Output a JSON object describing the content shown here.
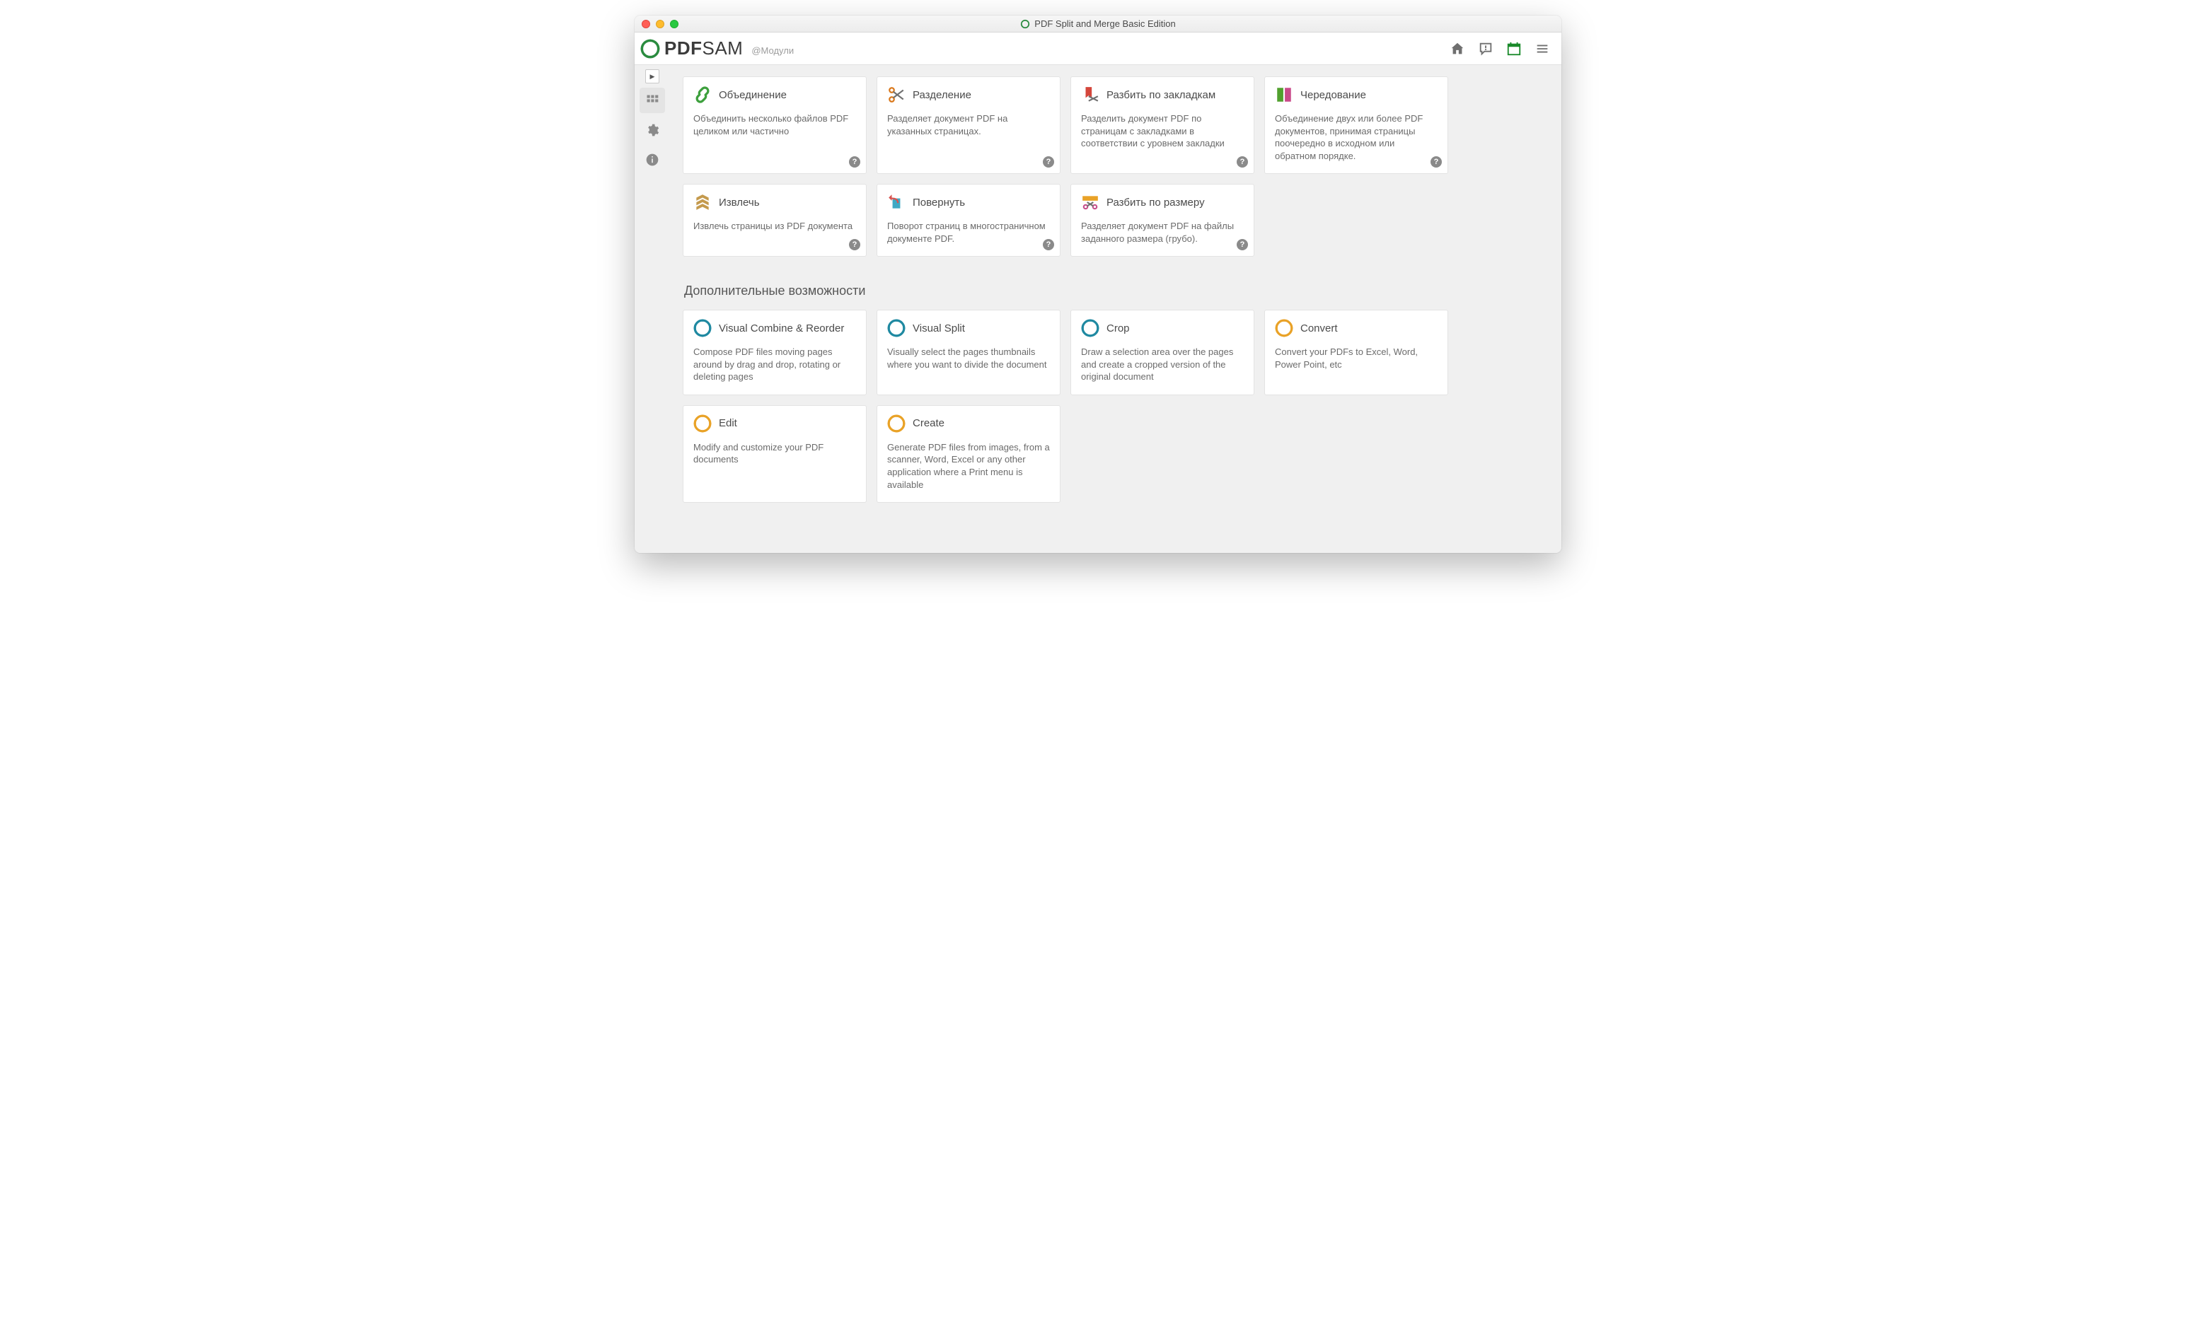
{
  "window": {
    "title": "PDF Split and Merge Basic Edition"
  },
  "appbar": {
    "brand_strong": "PDF",
    "brand_thin": "SAM",
    "breadcrumb": "@Модули"
  },
  "section_premium": "Дополнительные возможности",
  "modules": [
    {
      "id": "merge",
      "title": "Объединение",
      "desc": "Объединить несколько файлов PDF целиком или частично",
      "help": true,
      "icon": "link"
    },
    {
      "id": "split",
      "title": "Разделение",
      "desc": "Разделяет документ PDF на указанных страницах.",
      "help": true,
      "icon": "scissors"
    },
    {
      "id": "split-bookmarks",
      "title": "Разбить по закладкам",
      "desc": "Разделить документ PDF по страницам с закладками в соответствии с уровнем закладки",
      "help": true,
      "icon": "bookmark-cut"
    },
    {
      "id": "alternate",
      "title": "Чередование",
      "desc": "Объединение двух или более PDF документов, принимая страницы поочередно в исходном или обратном порядке.",
      "help": true,
      "icon": "alternate"
    },
    {
      "id": "extract",
      "title": "Извлечь",
      "desc": "Извлечь страницы из PDF документа",
      "help": true,
      "icon": "extract"
    },
    {
      "id": "rotate",
      "title": "Повернуть",
      "desc": "Поворот страниц в многостраничном документе PDF.",
      "help": true,
      "icon": "rotate"
    },
    {
      "id": "split-size",
      "title": "Разбить по размеру",
      "desc": "Разделяет документ PDF на файлы заданного размера (грубо).",
      "help": true,
      "icon": "ruler-cut"
    }
  ],
  "premium": [
    {
      "id": "visual-combine",
      "title": "Visual Combine & Reorder",
      "desc": "Compose PDF files moving pages around by drag and drop, rotating or deleting pages",
      "color": "blue"
    },
    {
      "id": "visual-split",
      "title": "Visual Split",
      "desc": "Visually select the pages thumbnails where you want to divide the document",
      "color": "blue"
    },
    {
      "id": "crop",
      "title": "Crop",
      "desc": "Draw a selection area over the pages and create a cropped version of the original document",
      "color": "blue"
    },
    {
      "id": "convert",
      "title": "Convert",
      "desc": "Convert your PDFs to Excel, Word, Power Point, etc",
      "color": "orange"
    },
    {
      "id": "edit",
      "title": "Edit",
      "desc": "Modify and customize your PDF documents",
      "color": "orange"
    },
    {
      "id": "create",
      "title": "Create",
      "desc": "Generate PDF files from images, from a scanner, Word, Excel or any other application where a Print menu is available",
      "color": "orange"
    }
  ]
}
